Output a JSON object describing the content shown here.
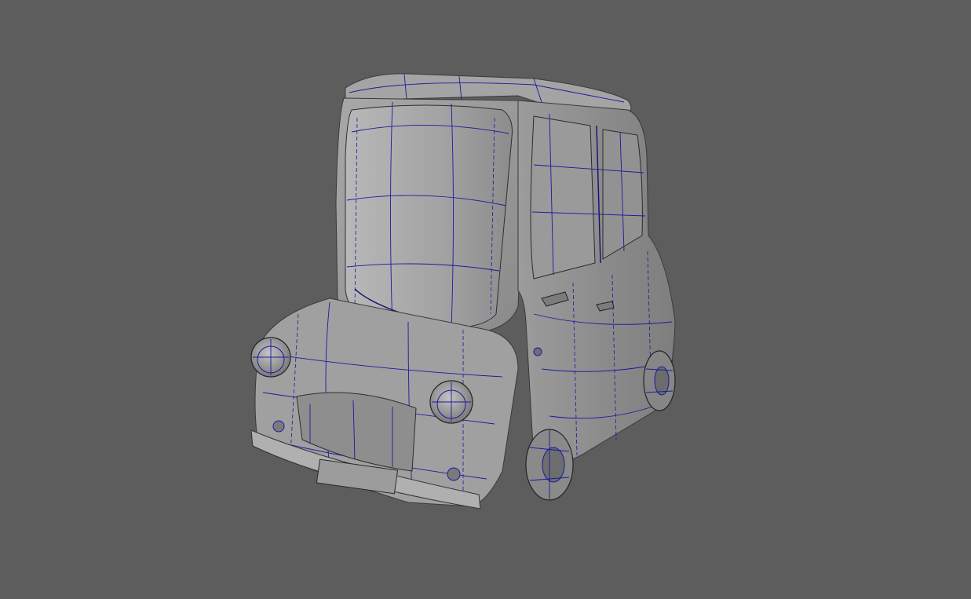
{
  "viewport": {
    "background": "#5d5d5d",
    "display_mode": "wireframe-on-shaded",
    "wire_color": "#1a1aa0",
    "shade_color": "#9a9a9a"
  },
  "model": {
    "icon": "cartoon-car-model"
  }
}
